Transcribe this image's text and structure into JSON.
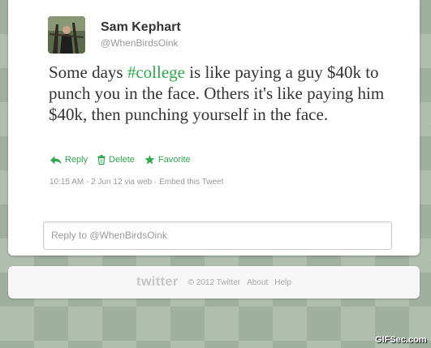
{
  "tweet": {
    "display_name": "Sam Kephart",
    "screen_name": "@WhenBirdsOink",
    "text_before": "Some days ",
    "hashtag": "#college",
    "text_after": " is like paying a guy $40k to punch you in the face. Others it's like paying him $40k, then punching yourself in the face.",
    "timestamp": "10:15 AM - 2 Jun 12 via web · Embed this Tweet"
  },
  "actions": {
    "reply_label": "Reply",
    "delete_label": "Delete",
    "favorite_label": "Favorite"
  },
  "reply_box": {
    "placeholder": "Reply to @WhenBirdsOink"
  },
  "footer": {
    "logo": "twitter",
    "copyright": "© 2012 Twitter",
    "about": "About",
    "help": "Help"
  },
  "watermark": "GIFSec.com",
  "colors": {
    "accent": "#2fa84f",
    "text": "#333333",
    "muted": "#999999"
  }
}
